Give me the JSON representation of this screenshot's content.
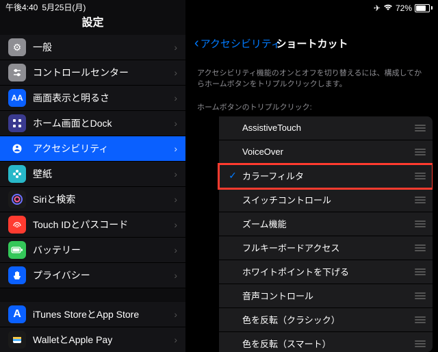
{
  "status": {
    "time": "午後4:40",
    "date": "5月25日(月)",
    "battery_pct": "72%"
  },
  "left": {
    "title": "設定",
    "section1": [
      {
        "label": "一般",
        "icon": "gear",
        "bg": "#8e8e93"
      },
      {
        "label": "コントロールセンター",
        "icon": "sliders",
        "bg": "#8e8e93"
      },
      {
        "label": "画面表示と明るさ",
        "icon": "AA",
        "bg": "#0a60ff"
      },
      {
        "label": "ホーム画面とDock",
        "icon": "grid",
        "bg": "#3a3a8f"
      },
      {
        "label": "アクセシビリティ",
        "icon": "person",
        "bg": "#0a60ff",
        "selected": true
      },
      {
        "label": "壁紙",
        "icon": "flower",
        "bg": "#28b8c9"
      },
      {
        "label": "Siriと検索",
        "icon": "siri",
        "bg": "#1a1a1a"
      },
      {
        "label": "Touch IDとパスコード",
        "icon": "finger",
        "bg": "#ff3b30"
      },
      {
        "label": "バッテリー",
        "icon": "batt",
        "bg": "#34c759"
      },
      {
        "label": "プライバシー",
        "icon": "hand",
        "bg": "#0a60ff"
      }
    ],
    "section2": [
      {
        "label": "iTunes StoreとApp Store",
        "icon": "A",
        "bg": "#0a60ff"
      },
      {
        "label": "WalletとApple Pay",
        "icon": "wallet",
        "bg": "#1a1a1a"
      }
    ]
  },
  "right": {
    "back": "アクセシビリティ",
    "title": "ショートカット",
    "desc": "アクセシビリティ機能のオンとオフを切り替えるには、構成してからホームボタンをトリプルクリックします。",
    "sub": "ホームボタンのトリプルクリック:",
    "items": [
      {
        "label": "AssistiveTouch",
        "checked": false
      },
      {
        "label": "VoiceOver",
        "checked": false
      },
      {
        "label": "カラーフィルタ",
        "checked": true,
        "highlight": true
      },
      {
        "label": "スイッチコントロール",
        "checked": false
      },
      {
        "label": "ズーム機能",
        "checked": false
      },
      {
        "label": "フルキーボードアクセス",
        "checked": false
      },
      {
        "label": "ホワイトポイントを下げる",
        "checked": false
      },
      {
        "label": "音声コントロール",
        "checked": false
      },
      {
        "label": "色を反転（クラシック）",
        "checked": false
      },
      {
        "label": "色を反転（スマート）",
        "checked": false
      }
    ]
  }
}
